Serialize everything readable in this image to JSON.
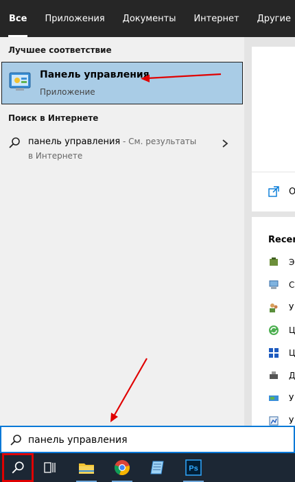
{
  "tabs": [
    {
      "label": "Все",
      "active": true
    },
    {
      "label": "Приложения",
      "active": false
    },
    {
      "label": "Документы",
      "active": false
    },
    {
      "label": "Интернет",
      "active": false
    },
    {
      "label": "Другие",
      "active": false
    }
  ],
  "best_match": {
    "section_title": "Лучшее соответствие",
    "name": "Панель управления",
    "type": "Приложение"
  },
  "web": {
    "section_title": "Поиск в Интернете",
    "query": "панель управления",
    "hint": " - См. результаты",
    "line2": "в Интернете"
  },
  "preview": {
    "open_label": "О",
    "recent_title": "Recent",
    "recent_items": [
      "Э.",
      "С",
      "У",
      "Ц",
      "Ц",
      "Д",
      "У",
      "У"
    ]
  },
  "search": {
    "value": "панель управления"
  },
  "taskbar": {
    "items": [
      "search-icon",
      "task-view-icon",
      "file-explorer-icon",
      "chrome-icon",
      "notepad-icon",
      "photoshop-icon"
    ],
    "photoshop_label": "Ps"
  },
  "colors": {
    "tabbar_bg": "#262626",
    "selected_result_bg": "#a9cce6",
    "search_border": "#0078d7",
    "taskbar_bg": "#1c2734",
    "annotation_red": "#e00000"
  }
}
